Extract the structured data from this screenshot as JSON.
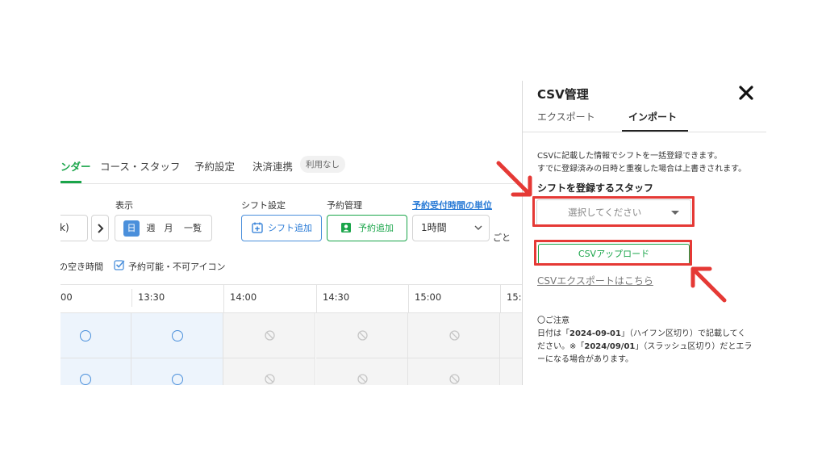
{
  "app": {
    "tabs": [
      {
        "label": "ンダー",
        "active": true
      },
      {
        "label": "コース・スタッフ",
        "active": false
      },
      {
        "label": "予約設定",
        "active": false
      },
      {
        "label": "決済連携",
        "active": false
      }
    ],
    "payment_badge": "利用なし",
    "display_label": "表示",
    "shift_settings_label": "シフト設定",
    "reservation_mgmt_label": "予約管理",
    "unit_link_label": "予約受付時間の単位",
    "date_value": "k)",
    "next_icon": "chevron-right-icon",
    "view_options": [
      {
        "label": "日",
        "active": true
      },
      {
        "label": "週",
        "active": false
      },
      {
        "label": "月",
        "active": false
      },
      {
        "label": "一覧",
        "active": false
      }
    ],
    "add_shift_label": "シフト追加",
    "add_reservation_label": "予約追加",
    "unit_value": "1時間",
    "unit_suffix": "ごと",
    "legend_free_time": "の空き時間",
    "legend_icon_toggle": "予約可能・不可アイコン",
    "times": [
      "00",
      "13:30",
      "14:00",
      "14:30",
      "15:00",
      "15:"
    ],
    "slot_rows": [
      [
        "available",
        "available",
        "unavailable",
        "unavailable",
        "unavailable",
        "unavailable"
      ],
      [
        "available",
        "available",
        "unavailable",
        "unavailable",
        "unavailable",
        "unavailable"
      ]
    ],
    "colors": {
      "accent_green": "#1aa54a",
      "accent_blue": "#4a8fdb",
      "annotation_red": "#e53935"
    }
  },
  "csv_panel": {
    "title": "CSV管理",
    "close_icon": "close-icon",
    "tabs": [
      {
        "label": "エクスポート",
        "active": false
      },
      {
        "label": "インポート",
        "active": true
      }
    ],
    "description_line1": "CSVに記載した情報でシフトを一括登録できます。",
    "description_line2": "すでに登録済みの日時と重複した場合は上書きされます。",
    "staff_label": "シフトを登録するスタッフ",
    "staff_placeholder": "選択してください",
    "upload_button": "CSVアップロード",
    "export_link": "CSVエクスポートはこちら",
    "note_title": "〇ご注意",
    "note_line1_prefix": "日付は「",
    "note_line1_date": "2024-09-01",
    "note_line1_suffix": "」（ハイフン区切り）で記載してく",
    "note_line2_prefix": "ださい。※「",
    "note_line2_date": "2024/09/01",
    "note_line2_suffix": "」（スラッシュ区切り）だとエラ",
    "note_line3": "ーになる場合があります。"
  }
}
